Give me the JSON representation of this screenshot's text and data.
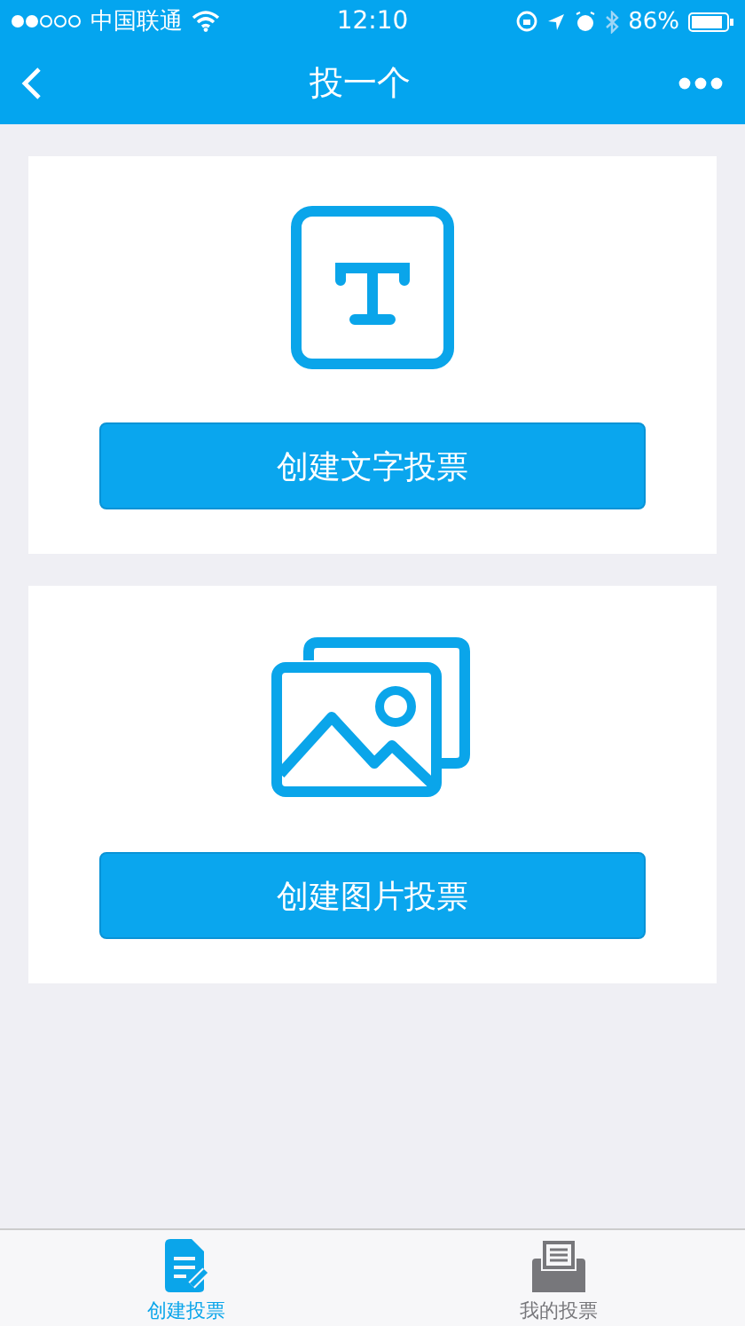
{
  "status_bar": {
    "carrier": "中国联通",
    "time": "12:10",
    "battery": "86%"
  },
  "nav": {
    "title": "投一个"
  },
  "cards": [
    {
      "kind": "text",
      "button": "创建文字投票"
    },
    {
      "kind": "image",
      "button": "创建图片投票"
    }
  ],
  "tabs": [
    {
      "label": "创建投票",
      "kind": "create",
      "selected": true
    },
    {
      "label": "我的投票",
      "kind": "mine",
      "selected": false
    }
  ]
}
